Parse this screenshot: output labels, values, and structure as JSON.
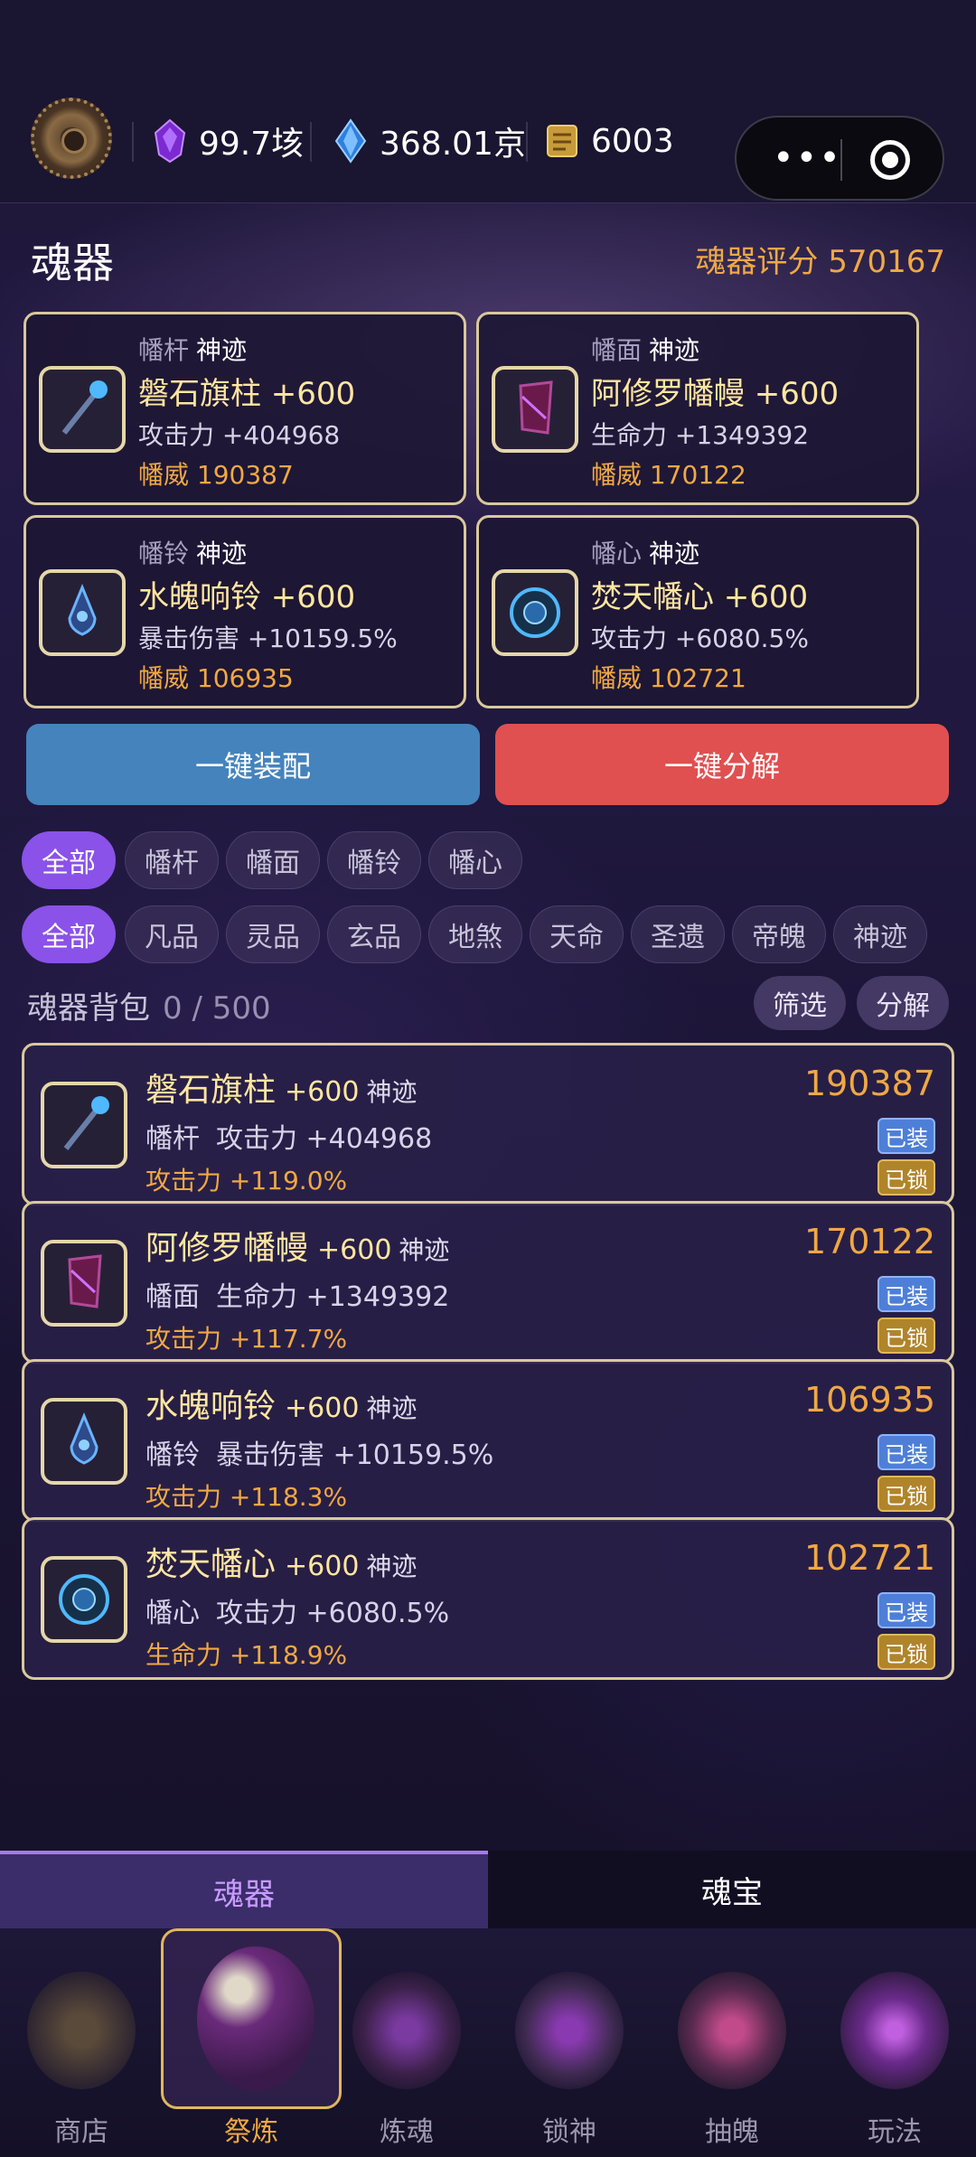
{
  "resources": [
    {
      "icon": "purple-gem-icon",
      "value": "99.7垓"
    },
    {
      "icon": "blue-crystal-icon",
      "value": "368.01京"
    },
    {
      "icon": "scroll-icon",
      "value": "6003"
    }
  ],
  "header": {
    "title": "魂器",
    "score_label": "魂器评分 570167"
  },
  "equipped": [
    {
      "type": "幡杆",
      "quality": "神迹",
      "name": "磐石旗柱 +600",
      "stat": "攻击力 +404968",
      "power": "幡威 190387"
    },
    {
      "type": "幡面",
      "quality": "神迹",
      "name": "阿修罗幡幔 +600",
      "stat": "生命力 +1349392",
      "power": "幡威 170122"
    },
    {
      "type": "幡铃",
      "quality": "神迹",
      "name": "水魄响铃 +600",
      "stat": "暴击伤害 +10159.5%",
      "power": "幡威 106935"
    },
    {
      "type": "幡心",
      "quality": "神迹",
      "name": "焚天幡心 +600",
      "stat": "攻击力 +6080.5%",
      "power": "幡威 102721"
    }
  ],
  "actions": {
    "equip_all": "一键装配",
    "decompose_all": "一键分解"
  },
  "type_filters": [
    "全部",
    "幡杆",
    "幡面",
    "幡铃",
    "幡心"
  ],
  "grade_filters": [
    "全部",
    "凡品",
    "灵品",
    "玄品",
    "地煞",
    "天命",
    "圣遗",
    "帝魄",
    "神迹"
  ],
  "bag": {
    "title": "魂器背包",
    "count": "0 / 500",
    "filter_btn": "筛选",
    "decompose_btn": "分解"
  },
  "items": [
    {
      "name": "磐石旗柱",
      "level": "+600",
      "quality": "神迹",
      "type": "幡杆",
      "stat": "攻击力 +404968",
      "bonus": "攻击力 +119.0%",
      "value": "190387",
      "equipped": "已装",
      "locked": "已锁"
    },
    {
      "name": "阿修罗幡幔",
      "level": "+600",
      "quality": "神迹",
      "type": "幡面",
      "stat": "生命力 +1349392",
      "bonus": "攻击力 +117.7%",
      "value": "170122",
      "equipped": "已装",
      "locked": "已锁"
    },
    {
      "name": "水魄响铃",
      "level": "+600",
      "quality": "神迹",
      "type": "幡铃",
      "stat": "暴击伤害 +10159.5%",
      "bonus": "攻击力 +118.3%",
      "value": "106935",
      "equipped": "已装",
      "locked": "已锁"
    },
    {
      "name": "焚天幡心",
      "level": "+600",
      "quality": "神迹",
      "type": "幡心",
      "stat": "攻击力 +6080.5%",
      "bonus": "生命力 +118.9%",
      "value": "102721",
      "equipped": "已装",
      "locked": "已锁"
    }
  ],
  "tabs": {
    "active": "魂器",
    "other": "魂宝"
  },
  "nav": [
    "商店",
    "祭炼",
    "炼魂",
    "锁神",
    "抽魄",
    "玩法"
  ],
  "colors": {
    "accent": "#8a52e8",
    "gold": "#f0a844",
    "equip_blue": "#4e7fd8",
    "decompose_red": "#e05050"
  }
}
